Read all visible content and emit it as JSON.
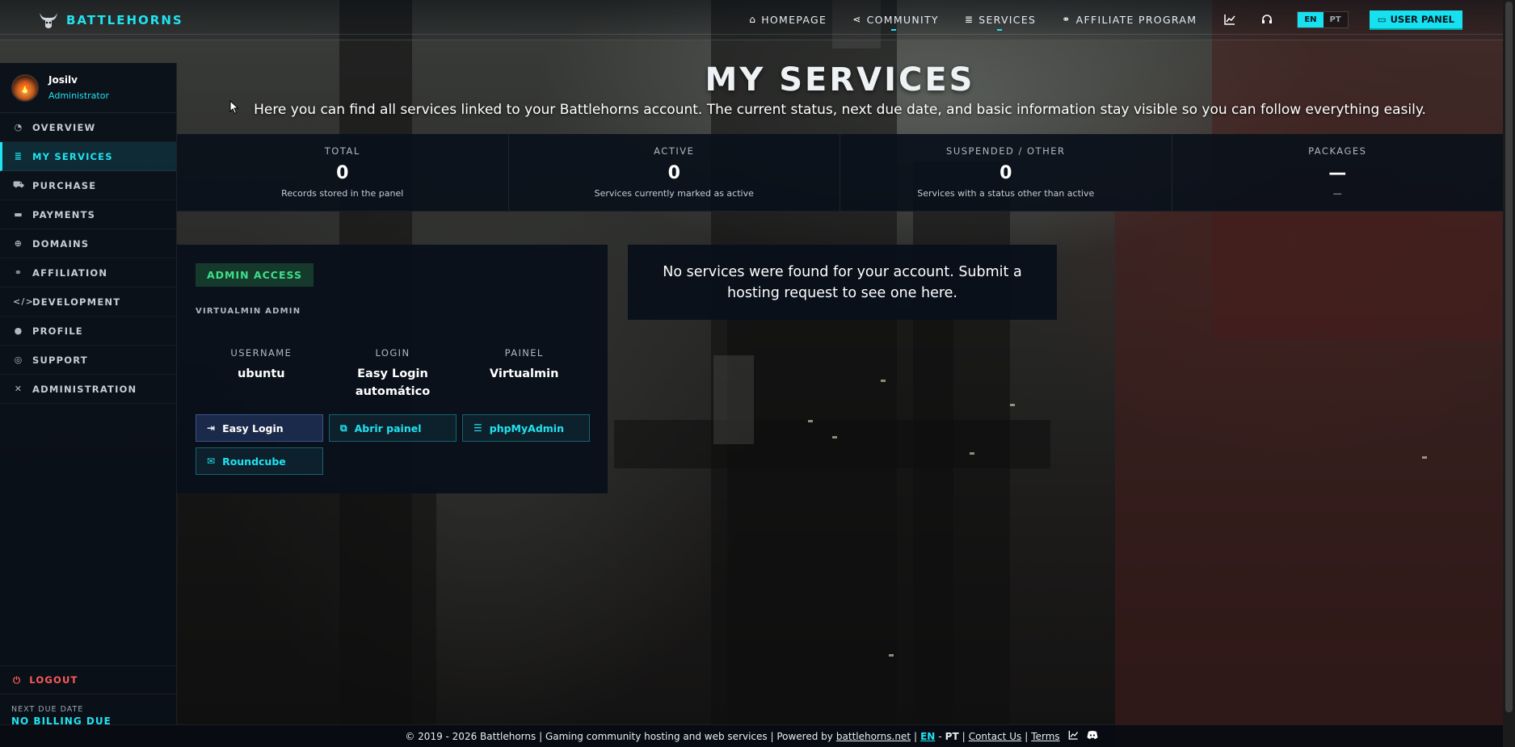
{
  "brand": {
    "name": "BATTLEHORNS"
  },
  "nav": {
    "items": [
      {
        "label": "HOMEPAGE",
        "icon": "home-icon"
      },
      {
        "label": "COMMUNITY",
        "icon": "share-icon"
      },
      {
        "label": "SERVICES",
        "icon": "server-icon"
      },
      {
        "label": "AFFILIATE PROGRAM",
        "icon": "handshake-icon"
      }
    ],
    "lang_en": "EN",
    "lang_pt": "PT",
    "user_panel": "USER PANEL"
  },
  "user": {
    "name": "Josilv",
    "role": "Administrator"
  },
  "sidebar": {
    "items": [
      {
        "label": "OVERVIEW",
        "icon": "gauge-icon"
      },
      {
        "label": "MY SERVICES",
        "icon": "server-icon"
      },
      {
        "label": "PURCHASE",
        "icon": "cart-icon"
      },
      {
        "label": "PAYMENTS",
        "icon": "wallet-icon"
      },
      {
        "label": "DOMAINS",
        "icon": "globe-icon"
      },
      {
        "label": "AFFILIATION",
        "icon": "handshake-icon"
      },
      {
        "label": "DEVELOPMENT",
        "icon": "code-icon"
      },
      {
        "label": "PROFILE",
        "icon": "user-icon"
      },
      {
        "label": "SUPPORT",
        "icon": "headset-icon"
      },
      {
        "label": "ADMINISTRATION",
        "icon": "tools-icon"
      }
    ],
    "logout": "LOGOUT",
    "due_label": "NEXT DUE DATE",
    "due_value": "NO BILLING DUE"
  },
  "header": {
    "title": "MY SERVICES",
    "subtitle": "Here you can find all services linked to your Battlehorns account. The current status, next due date, and basic information stay visible so you can follow everything easily."
  },
  "stats": [
    {
      "label": "TOTAL",
      "value": "0",
      "desc": "Records stored in the panel"
    },
    {
      "label": "ACTIVE",
      "value": "0",
      "desc": "Services currently marked as active"
    },
    {
      "label": "SUSPENDED / OTHER",
      "value": "0",
      "desc": "Services with a status other than active"
    },
    {
      "label": "PACKAGES",
      "value": "—",
      "desc": "—"
    }
  ],
  "admin": {
    "badge": "ADMIN ACCESS",
    "subtitle": "VIRTUALMIN ADMIN",
    "cols": [
      {
        "label": "USERNAME",
        "value": "ubuntu"
      },
      {
        "label": "LOGIN",
        "value": "Easy Login automático"
      },
      {
        "label": "PAINEL",
        "value": "Virtualmin"
      }
    ],
    "buttons": [
      {
        "label": "Easy Login",
        "icon": "sign-in-icon"
      },
      {
        "label": "Abrir painel",
        "icon": "external-link-icon"
      },
      {
        "label": "phpMyAdmin",
        "icon": "database-icon"
      },
      {
        "label": "Roundcube",
        "icon": "envelope-icon"
      }
    ]
  },
  "empty_message": "No services were found for your account. Submit a hosting request to see one here.",
  "footer": {
    "copyright": "© 2019 - 2026 Battlehorns | Gaming community hosting and web services | Powered by",
    "powered_link": "battlehorns.net",
    "sep1": "|",
    "en": "EN",
    "dash": "-",
    "pt": "PT",
    "sep2": "|",
    "contact": "Contact Us",
    "sep3": "|",
    "terms": "Terms"
  },
  "colors": {
    "accent": "#20e3f0",
    "danger": "#ff5a5a",
    "success": "#3ee08a"
  }
}
